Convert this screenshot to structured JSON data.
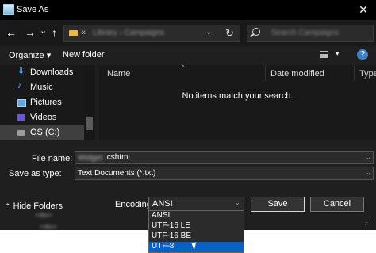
{
  "window": {
    "title": "Save As",
    "close_glyph": "✕"
  },
  "nav": {
    "back_glyph": "←",
    "forward_glyph": "→",
    "history_glyph": "⌄",
    "up_glyph": "↑",
    "address_chevron": "«",
    "address_path": "Library  ›  Campaigns",
    "address_dropdown_glyph": "⌄",
    "refresh_glyph": "↻",
    "search_placeholder": "Search Campaigns"
  },
  "toolbar": {
    "organize": "Organize ▾",
    "new_folder": "New folder",
    "view_dropdown": "▾",
    "help": "?"
  },
  "sidebar": {
    "items": [
      {
        "label": "Downloads",
        "icon": "download-icon"
      },
      {
        "label": "Music",
        "icon": "music-icon"
      },
      {
        "label": "Pictures",
        "icon": "pictures-icon"
      },
      {
        "label": "Videos",
        "icon": "videos-icon"
      },
      {
        "label": "OS (C:)",
        "icon": "drive-icon"
      }
    ]
  },
  "filelist": {
    "columns": [
      "Name",
      "Date modified",
      "Type"
    ],
    "empty_message": "No items match your search."
  },
  "form": {
    "filename_label": "File name:",
    "filename_hidden": "Widget",
    "filename_ext": ".cshtml",
    "savetype_label": "Save as type:",
    "savetype_value": "Text Documents (*.txt)",
    "hide_folders": "Hide Folders",
    "encoding_label": "Encoding:",
    "encoding_value": "ANSI",
    "save": "Save",
    "cancel": "Cancel"
  },
  "encoding_options": [
    "ANSI",
    "UTF-16 LE",
    "UTF-16 BE",
    "UTF-8"
  ],
  "encoding_selected": "UTF-8",
  "background": {
    "line1": "<div>",
    "line2": "<div>"
  },
  "colors": {
    "accent": "#0a60c4",
    "dialog_bg": "#1f1f1f",
    "titlebar": "#000000"
  }
}
